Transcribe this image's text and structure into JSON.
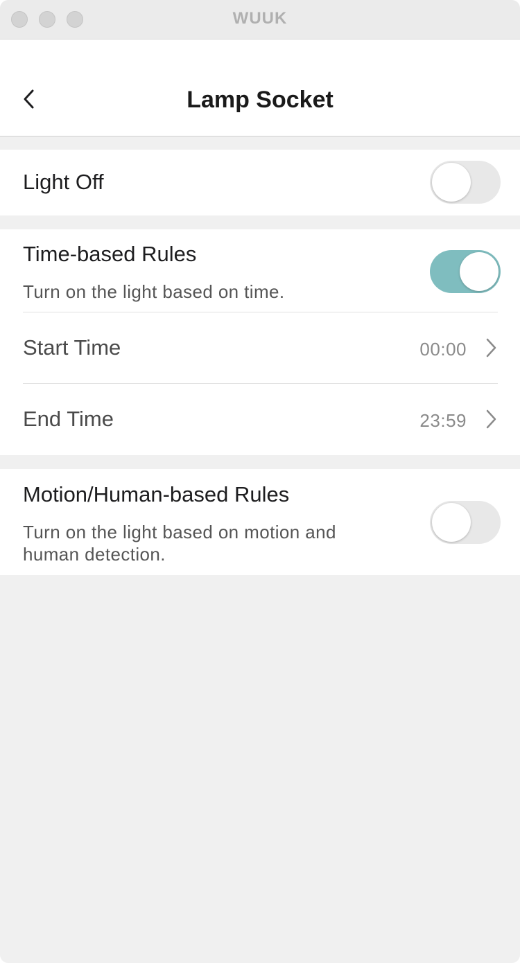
{
  "window": {
    "title": "WUUK"
  },
  "nav": {
    "title": "Lamp Socket"
  },
  "light": {
    "label": "Light Off",
    "enabled": false
  },
  "time_rules": {
    "label": "Time-based Rules",
    "description": "Turn on the light based on time.",
    "enabled": true,
    "start": {
      "label": "Start Time",
      "value": "00:00"
    },
    "end": {
      "label": "End Time",
      "value": "23:59"
    }
  },
  "motion_rules": {
    "label": "Motion/Human-based Rules",
    "description_line1": "Turn on the light based on motion and",
    "description_line2": "human detection.",
    "enabled": false
  },
  "colors": {
    "accent": "#7fbdbf",
    "toggle_off": "#e8e8e8",
    "background": "#f0f0f0"
  }
}
